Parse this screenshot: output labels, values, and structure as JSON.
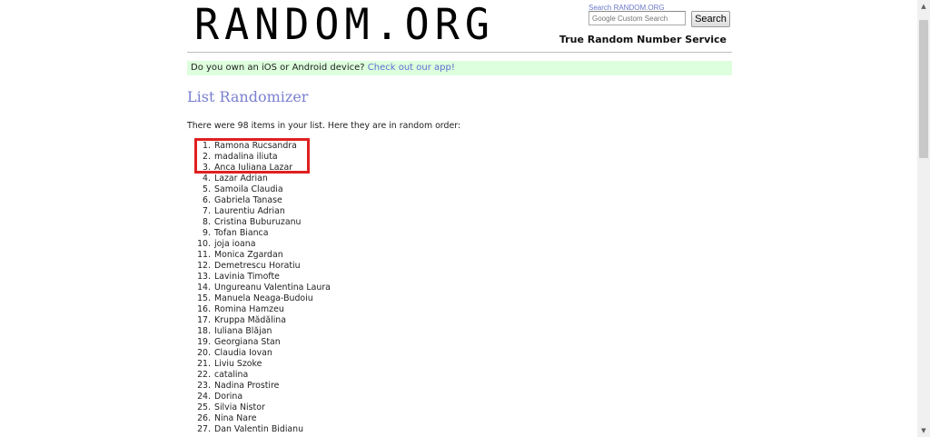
{
  "header": {
    "logo": "RANDOM.ORG",
    "search_caption": "Search RANDOM.ORG",
    "search_placeholder": "Google Custom Search",
    "search_button": "Search",
    "tagline": "True Random Number Service"
  },
  "promo": {
    "text": "Do you own an iOS or Android device? ",
    "link": "Check out our app!"
  },
  "main": {
    "heading": "List Randomizer",
    "intro": "There were 98 items in your list. Here they are in random order:",
    "items": [
      {
        "num": "1.",
        "name": "Ramona Rucsandra"
      },
      {
        "num": "2.",
        "name": "madalina iliuta"
      },
      {
        "num": "3.",
        "name": "Anca Iuliana Lazar"
      },
      {
        "num": "4.",
        "name": "Lazar Adrian"
      },
      {
        "num": "5.",
        "name": "Samoila Claudia"
      },
      {
        "num": "6.",
        "name": "Gabriela Tanase"
      },
      {
        "num": "7.",
        "name": "Laurentiu Adrian"
      },
      {
        "num": "8.",
        "name": "Cristina Buburuzanu"
      },
      {
        "num": "9.",
        "name": "Tofan Bianca"
      },
      {
        "num": "10.",
        "name": "joja ioana"
      },
      {
        "num": "11.",
        "name": "Monica Zgardan"
      },
      {
        "num": "12.",
        "name": "Demetrescu Horatiu"
      },
      {
        "num": "13.",
        "name": "Lavinia Timofte"
      },
      {
        "num": "14.",
        "name": "Ungureanu Valentina Laura"
      },
      {
        "num": "15.",
        "name": "Manuela Neaga-Budoiu"
      },
      {
        "num": "16.",
        "name": "Romina Hamzeu"
      },
      {
        "num": "17.",
        "name": "Kruppa Mădălina"
      },
      {
        "num": "18.",
        "name": "Iuliana Blăjan"
      },
      {
        "num": "19.",
        "name": "Georgiana Stan"
      },
      {
        "num": "20.",
        "name": "Claudia Iovan"
      },
      {
        "num": "21.",
        "name": "Liviu Szoke"
      },
      {
        "num": "22.",
        "name": "catalina"
      },
      {
        "num": "23.",
        "name": "Nadina Prostire"
      },
      {
        "num": "24.",
        "name": "Dorina"
      },
      {
        "num": "25.",
        "name": "Silvia Nistor"
      },
      {
        "num": "26.",
        "name": "Nina Nare"
      },
      {
        "num": "27.",
        "name": "Dan Valentin Bidianu"
      }
    ]
  },
  "colors": {
    "highlight": "#e02020",
    "promo_bg": "#ddffdd",
    "heading": "#7a80cf",
    "link": "#5e6ed2"
  },
  "icons": [
    "scroll-up-arrow-icon",
    "scroll-down-arrow-icon"
  ]
}
